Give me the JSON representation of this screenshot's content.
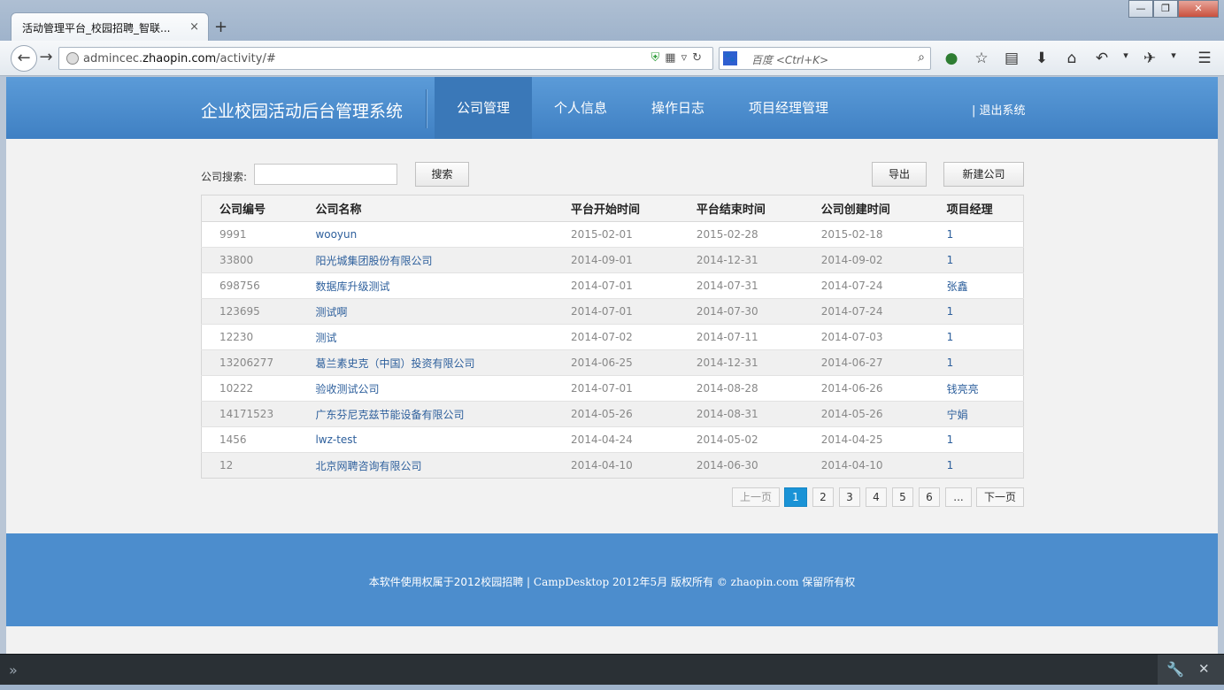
{
  "browser": {
    "tab_title": "活动管理平台_校园招聘_智联...",
    "tab_close": "×",
    "new_tab": "+",
    "url_prefix": "admincec.",
    "url_domain": "zhaopin.com",
    "url_path": "/activity/#",
    "search_placeholder": "百度 <Ctrl+K>",
    "window_buttons": [
      "—",
      "❐",
      "✕"
    ]
  },
  "header": {
    "brand": "企业校园活动后台管理系统",
    "menu": [
      "公司管理",
      "个人信息",
      "操作日志",
      "项目经理管理"
    ],
    "active_menu": "公司管理",
    "logout": "| 退出系统"
  },
  "toolbar": {
    "search_label": "公司搜索:",
    "search_value": "",
    "search_button": "搜索",
    "export_button": "导出",
    "new_button": "新建公司"
  },
  "table": {
    "columns": [
      "公司编号",
      "公司名称",
      "平台开始时间",
      "平台结束时间",
      "公司创建时间",
      "项目经理"
    ],
    "rows": [
      [
        "9991",
        "wooyun",
        "2015-02-01",
        "2015-02-28",
        "2015-02-18",
        "1"
      ],
      [
        "33800",
        "阳光城集团股份有限公司",
        "2014-09-01",
        "2014-12-31",
        "2014-09-02",
        "1"
      ],
      [
        "698756",
        "数据库升级测试",
        "2014-07-01",
        "2014-07-31",
        "2014-07-24",
        "张鑫"
      ],
      [
        "123695",
        "测试啊",
        "2014-07-01",
        "2014-07-30",
        "2014-07-24",
        "1"
      ],
      [
        "12230",
        "测试",
        "2014-07-02",
        "2014-07-11",
        "2014-07-03",
        "1"
      ],
      [
        "13206277",
        "葛兰素史克（中国）投资有限公司",
        "2014-06-25",
        "2014-12-31",
        "2014-06-27",
        "1"
      ],
      [
        "10222",
        "验收测试公司",
        "2014-07-01",
        "2014-08-28",
        "2014-06-26",
        "钱亮亮"
      ],
      [
        "14171523",
        "广东芬尼克兹节能设备有限公司",
        "2014-05-26",
        "2014-08-31",
        "2014-05-26",
        "宁娟"
      ],
      [
        "1456",
        "lwz-test",
        "2014-04-24",
        "2014-05-02",
        "2014-04-25",
        "1"
      ],
      [
        "12",
        "北京网聘咨询有限公司",
        "2014-04-10",
        "2014-06-30",
        "2014-04-10",
        "1"
      ]
    ]
  },
  "pagination": {
    "prev": "上一页",
    "pages": [
      "1",
      "2",
      "3",
      "4",
      "5",
      "6",
      "..."
    ],
    "current": "1",
    "next": "下一页"
  },
  "footer": {
    "text_a": "本软件使用权属于2012校园招聘 | ",
    "text_b": "CampDesktop 2012年5月 版权所有 © zhaopin.com",
    "text_c": " 保留所有权"
  },
  "devtools": {
    "prompt": "»"
  },
  "colors": {
    "header_blue": "#4c8dcd",
    "active_menu": "#3a78b8",
    "link": "#2d5f9c",
    "current_page": "#1a93d6"
  }
}
